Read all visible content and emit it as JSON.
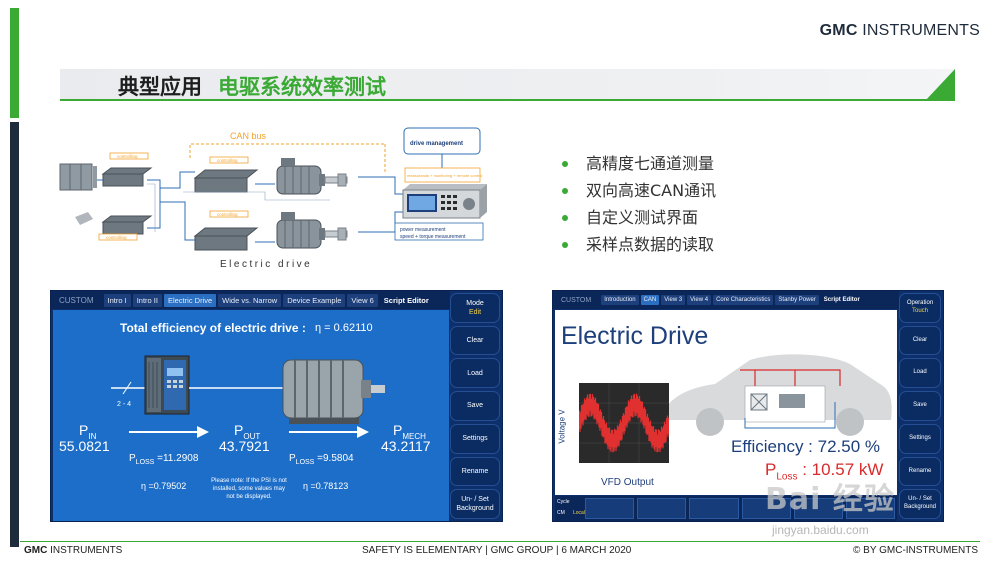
{
  "brand": {
    "part1": "GMC",
    "part2": " INSTRUMENTS"
  },
  "title": {
    "part1": "典型应用",
    "part2": "电驱系统效率测试"
  },
  "bullets": [
    "高精度七通道测量",
    "双向高速CAN通讯",
    "自定义测试界面",
    "采样点数据的读取"
  ],
  "diagram": {
    "can_label": "CAN bus",
    "drive_mgmt": "drive management",
    "measure_box": "measurands + monitoring + remote control",
    "power_box_1": "power measurement",
    "power_box_2": "speed + torque measurement",
    "controlling": "controlling",
    "caption": "Electric drive"
  },
  "left_screen": {
    "tabs": [
      "CUSTOM",
      "Intro I",
      "Intro II",
      "Electric Drive",
      "Wide vs. Narrow",
      "Device Example",
      "View 6",
      "Script Editor"
    ],
    "heading": "Total efficiency of electric drive :",
    "eta_total": "η  = 0.62110",
    "pin_label": "P",
    "pin_sub": "IN",
    "pin_value": "55.0821",
    "pout_label": "P",
    "pout_sub": "OUT",
    "pout_value": "43.7921",
    "pmech_label": "P",
    "pmech_sub": "MECH",
    "pmech_value": "43.2117",
    "ploss1": "=11.2908",
    "ploss2": "=9.5804",
    "ploss_label": "P",
    "ploss_sub": "LOSS",
    "eta1": "η  =0.79502",
    "eta2": "η  =0.78123",
    "note": "Please note: If the PSI is not installed, some values may not be displayed.",
    "phase_label": "2 - 4",
    "buttons": [
      {
        "label": "Mode",
        "sub": "Edit"
      },
      {
        "label": "Clear",
        "sub": ""
      },
      {
        "label": "Load",
        "sub": ""
      },
      {
        "label": "Save",
        "sub": ""
      },
      {
        "label": "Settings",
        "sub": ""
      },
      {
        "label": "Rename",
        "sub": ""
      },
      {
        "label": "Un- / Set Background",
        "sub": ""
      }
    ]
  },
  "right_screen": {
    "tabs": [
      "CUSTOM",
      "Introduction",
      "CAN",
      "View 3",
      "View 4",
      "Core Characteristics",
      "Stanby Power",
      "Script Editor"
    ],
    "heading": "Electric Drive",
    "chart_ylabel": "Voltage V",
    "chart_caption": "VFD Output",
    "efficiency": "Efficiency : 72.50 %",
    "ploss_label": "P",
    "ploss_sub": "Loss",
    "ploss_value": " : 10.57 kW",
    "status_left_1": "Cycle",
    "status_left_2": "CM",
    "status_local": "Local",
    "buttons": [
      {
        "label": "Operation",
        "sub": "Touch"
      },
      {
        "label": "Clear",
        "sub": ""
      },
      {
        "label": "Load",
        "sub": ""
      },
      {
        "label": "Save",
        "sub": ""
      },
      {
        "label": "Settings",
        "sub": ""
      },
      {
        "label": "Rename",
        "sub": ""
      },
      {
        "label": "Un- / Set Background",
        "sub": ""
      }
    ]
  },
  "footer": {
    "left_brand_1": "GMC",
    "left_brand_2": " INSTRUMENTS",
    "center": "SAFETY IS ELEMENTARY | GMC GROUP | 6 MARCH 2020",
    "right": "© BY GMC-INSTRUMENTS"
  },
  "watermark": {
    "main": "Bai 经验",
    "url": "jingyan.baidu.com"
  },
  "colors": {
    "accent_green": "#3aaa35",
    "dark_navy": "#1e2b3a",
    "screen_blue": "#1d6ec9"
  }
}
